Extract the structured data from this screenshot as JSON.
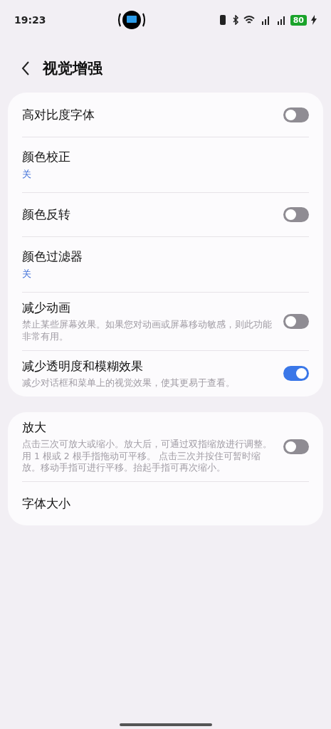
{
  "status_bar": {
    "time": "19:23",
    "battery": "80"
  },
  "header": {
    "title": "视觉增强"
  },
  "groups": [
    {
      "items": [
        {
          "kind": "switch",
          "title": "高对比度字体",
          "on": false
        },
        {
          "kind": "value",
          "title": "颜色校正",
          "value": "关"
        },
        {
          "kind": "switch",
          "title": "颜色反转",
          "on": false
        },
        {
          "kind": "value",
          "title": "颜色过滤器",
          "value": "关"
        },
        {
          "kind": "switch",
          "title": "减少动画",
          "description": "禁止某些屏幕效果。如果您对动画或屏幕移动敏感，则此功能非常有用。",
          "on": false
        },
        {
          "kind": "switch",
          "title": "减少透明度和模糊效果",
          "description": "减少对话框和菜单上的视觉效果，使其更易于查看。",
          "on": true
        }
      ]
    },
    {
      "items": [
        {
          "kind": "switch",
          "title": "放大",
          "description": "点击三次可放大或缩小。放大后，可通过双指缩放进行调整。用 1 根或 2 根手指拖动可平移。 点击三次并按住可暂时缩放。移动手指可进行平移。抬起手指可再次缩小。",
          "on": false
        },
        {
          "kind": "value",
          "title": "字体大小"
        }
      ]
    }
  ]
}
